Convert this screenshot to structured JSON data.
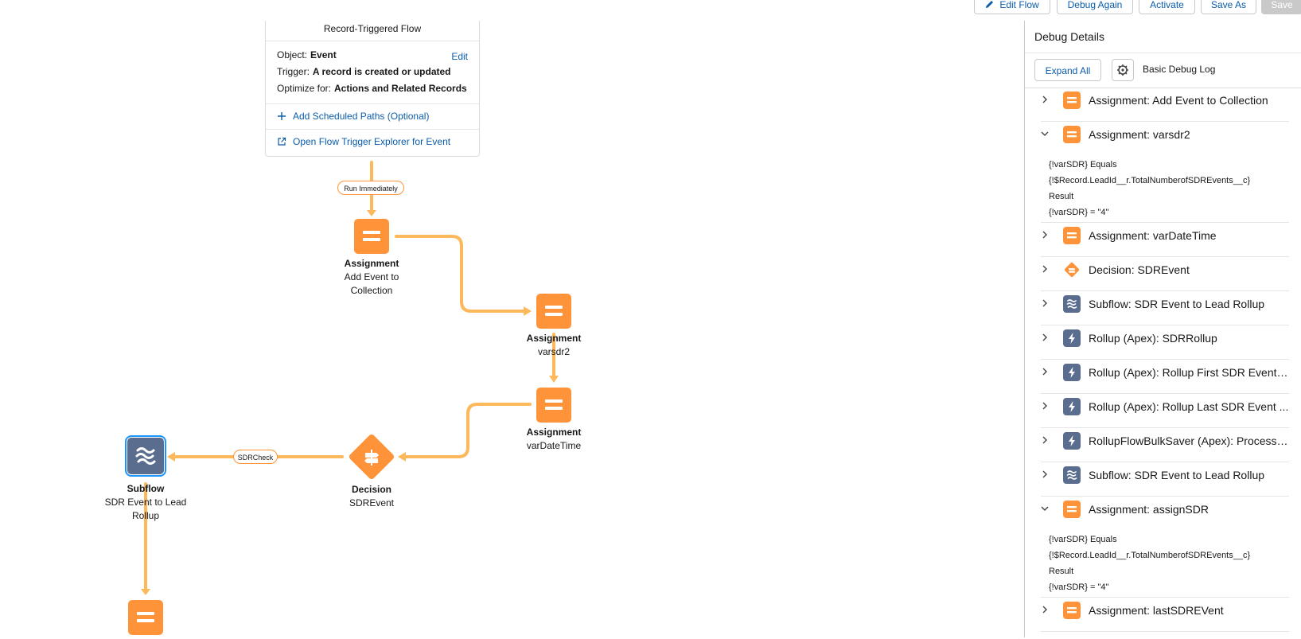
{
  "toolbar": {
    "edit_flow": "Edit Flow",
    "debug_again": "Debug Again",
    "activate": "Activate",
    "save_as": "Save As",
    "save": "Save"
  },
  "start_card": {
    "title": "Record-Triggered Flow",
    "object_label": "Object:",
    "object_value": "Event",
    "edit": "Edit",
    "trigger_label": "Trigger:",
    "trigger_value": "A record is created or updated",
    "optimize_label": "Optimize for:",
    "optimize_value": "Actions and Related Records",
    "add_paths": "Add Scheduled Paths (Optional)",
    "open_explorer": "Open Flow Trigger Explorer for Event"
  },
  "connectors": {
    "run_immediately": "Run Immediately",
    "sdrcheck": "SDRCheck"
  },
  "nodes": {
    "assign1": {
      "type": "Assignment",
      "name": "Add Event to Collection"
    },
    "assign2": {
      "type": "Assignment",
      "name": "varsdr2"
    },
    "assign3": {
      "type": "Assignment",
      "name": "varDateTime"
    },
    "decision": {
      "type": "Decision",
      "name": "SDREvent"
    },
    "subflow": {
      "type": "Subflow",
      "name": "SDR Event to Lead Rollup"
    }
  },
  "panel": {
    "title": "Debug Details",
    "expand_all": "Expand All",
    "log_label": "Basic Debug Log",
    "items": [
      {
        "label": "Assignment: Add Event to Collection",
        "icon": "assignment-icon",
        "expanded": false
      },
      {
        "label": "Assignment: varsdr2",
        "icon": "assignment-icon",
        "expanded": true,
        "details": [
          "{!varSDR} Equals",
          "{!$Record.LeadId__r.TotalNumberofSDREvents__c}",
          "Result",
          "{!varSDR} = \"4\""
        ]
      },
      {
        "label": "Assignment: varDateTime",
        "icon": "assignment-icon",
        "expanded": false
      },
      {
        "label": "Decision: SDREvent",
        "icon": "decision-icon",
        "expanded": false
      },
      {
        "label": "Subflow: SDR Event to Lead Rollup",
        "icon": "subflow-icon",
        "expanded": false
      },
      {
        "label": "Rollup (Apex): SDRRollup",
        "icon": "apex-icon",
        "expanded": false
      },
      {
        "label": "Rollup (Apex): Rollup First SDR Event ...",
        "icon": "apex-icon",
        "expanded": false
      },
      {
        "label": "Rollup (Apex): Rollup Last SDR Event ...",
        "icon": "apex-icon",
        "expanded": false
      },
      {
        "label": "RollupFlowBulkSaver (Apex): Process ...",
        "icon": "apex-icon",
        "expanded": false
      },
      {
        "label": "Subflow: SDR Event to Lead Rollup",
        "icon": "subflow-icon",
        "expanded": false
      },
      {
        "label": "Assignment: assignSDR",
        "icon": "assignment-icon",
        "expanded": true,
        "details": [
          "{!varSDR} Equals",
          "{!$Record.LeadId__r.TotalNumberofSDREvents__c}",
          "Result",
          "{!varSDR} = \"4\""
        ]
      },
      {
        "label": "Assignment: lastSDREVent",
        "icon": "assignment-icon",
        "expanded": false
      }
    ]
  },
  "colors": {
    "brand_blue": "#0b5cab",
    "orange": "#fe9339",
    "connector": "#fcb95b",
    "navy": "#5a6d8f"
  }
}
